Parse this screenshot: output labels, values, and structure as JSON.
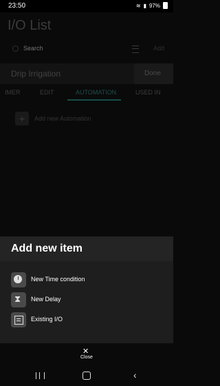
{
  "status_bar": {
    "time": "23:50",
    "battery": "97%",
    "icons": [
      "battery-saver-icon",
      "alarm-icon",
      "wifi-icon",
      "volte-icon",
      "signal-icon",
      "battery-icon"
    ]
  },
  "app": {
    "title": "I/O List",
    "search_placeholder": "Search",
    "add_label": "Add"
  },
  "device": {
    "name": "Drip Irrigation",
    "done_label": "Done"
  },
  "tabs": [
    {
      "label": "IMER",
      "active": false
    },
    {
      "label": "EDIT",
      "active": false
    },
    {
      "label": "AUTOMATION",
      "active": true
    },
    {
      "label": "USED IN",
      "active": false
    }
  ],
  "automation": {
    "add_label": "Add new Automation"
  },
  "sheet": {
    "title": "Add new item",
    "items": [
      {
        "label": "New Time condition",
        "icon": "clock-icon"
      },
      {
        "label": "New Delay",
        "icon": "hourglass-icon"
      },
      {
        "label": "Existing I/O",
        "icon": "list-icon"
      }
    ],
    "close_label": "Close"
  },
  "colors": {
    "accent": "#1e4f4b",
    "sheet_bg": "#1e1e1e",
    "background": "#0a0a0a"
  }
}
